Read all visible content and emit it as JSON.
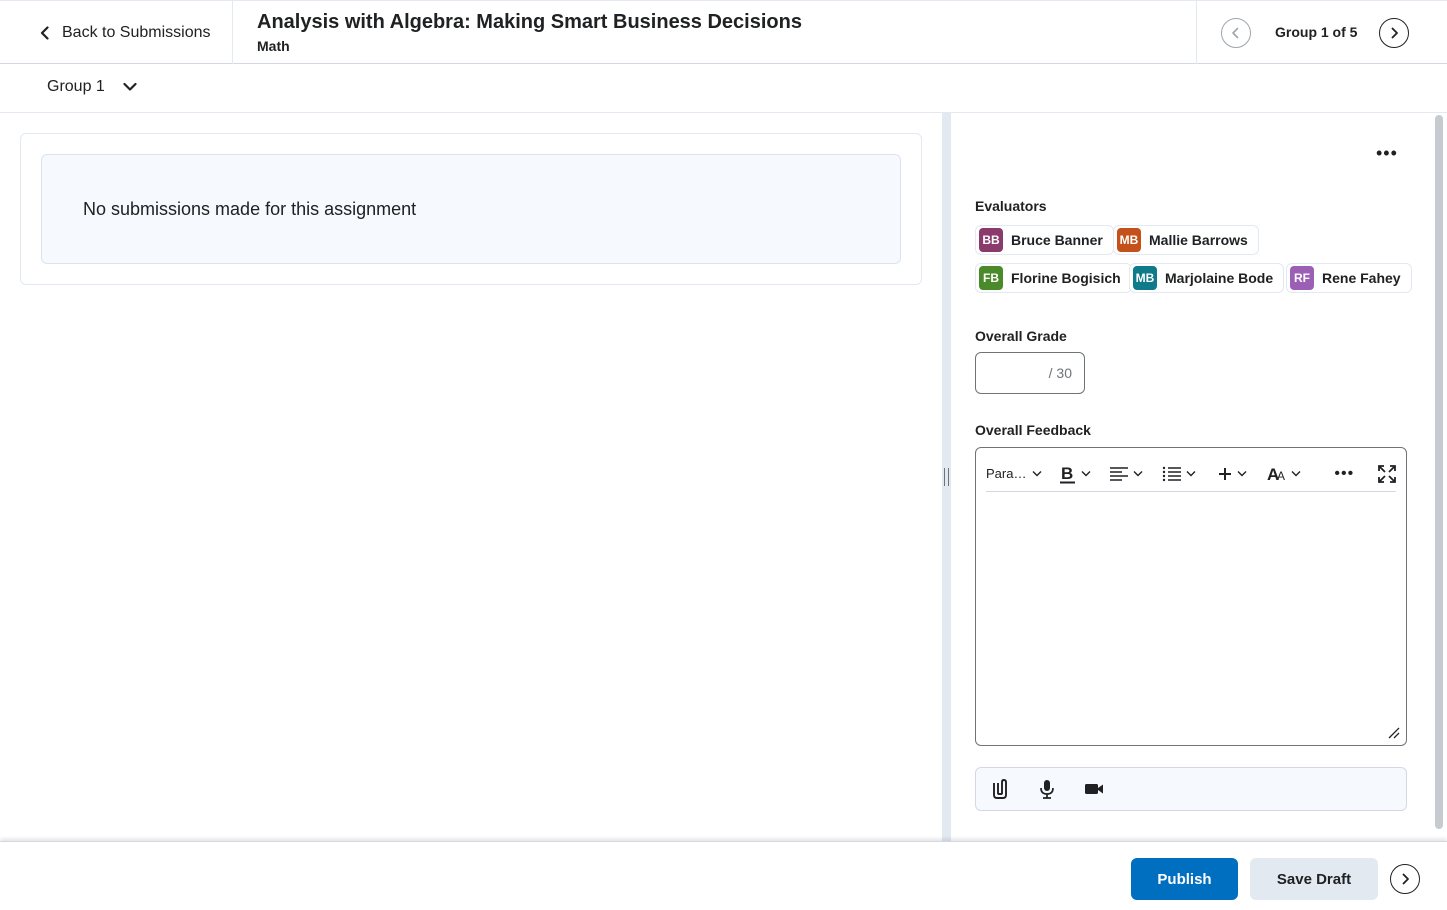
{
  "header": {
    "back_label": "Back to Submissions",
    "title": "Analysis with Algebra: Making Smart Business Decisions",
    "subtitle": "Math",
    "nav_label": "Group 1 of 5"
  },
  "group_selector": {
    "selected": "Group 1"
  },
  "submission": {
    "empty_message": "No submissions made for this assignment"
  },
  "evaluators": {
    "label": "Evaluators",
    "items": [
      {
        "initials": "BB",
        "name": "Bruce Banner",
        "color": "#8a3b6b"
      },
      {
        "initials": "MB",
        "name": "Mallie Barrows",
        "color": "#c4501a"
      },
      {
        "initials": "FB",
        "name": "Florine Bogisich",
        "color": "#4a8a2b"
      },
      {
        "initials": "MB",
        "name": "Marjolaine Bode",
        "color": "#0f7a8a"
      },
      {
        "initials": "RF",
        "name": "Rene Fahey",
        "color": "#9b5fb5"
      }
    ]
  },
  "grade": {
    "label": "Overall Grade",
    "value": "",
    "out_of": "/ 30"
  },
  "feedback": {
    "label": "Overall Feedback",
    "format_label": "Para…",
    "content": ""
  },
  "footer": {
    "publish_label": "Publish",
    "save_draft_label": "Save Draft"
  },
  "colors": {
    "primary": "#006fbf",
    "border": "#e3e9f1",
    "text": "#202122"
  }
}
